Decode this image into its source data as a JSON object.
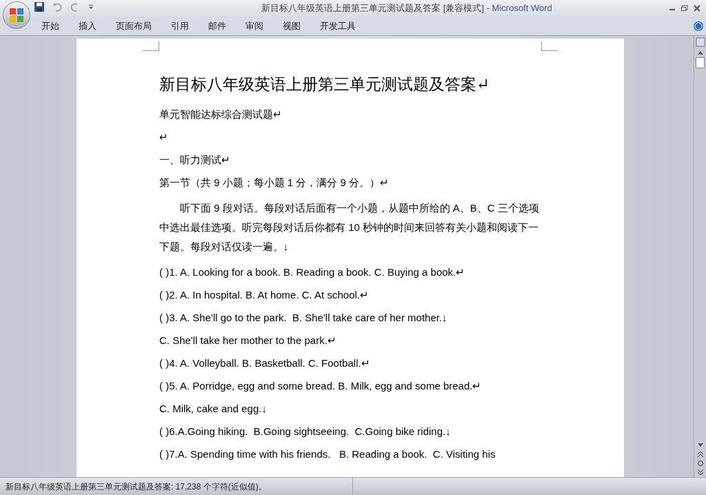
{
  "window": {
    "title": "新目标八年级英语上册第三单元测试题及答案 [兼容模式]",
    "separator": "-",
    "app_name": "Microsoft Word"
  },
  "ribbon_tabs": [
    {
      "label": "开始",
      "selected": false
    },
    {
      "label": "插入",
      "selected": false
    },
    {
      "label": "页面布局",
      "selected": false
    },
    {
      "label": "引用",
      "selected": false
    },
    {
      "label": "邮件",
      "selected": false
    },
    {
      "label": "审阅",
      "selected": false
    },
    {
      "label": "视图",
      "selected": false
    },
    {
      "label": "开发工具",
      "selected": false
    }
  ],
  "document": {
    "paragraphs": [
      {
        "kind": "title",
        "text": "新目标八年级英语上册第三单元测试题及答案↵"
      },
      {
        "kind": "text",
        "text": "单元智能达标综合测试题↵"
      },
      {
        "kind": "text",
        "text": "↵"
      },
      {
        "kind": "text",
        "text": "一、听力测试↵"
      },
      {
        "kind": "text",
        "text": "第一节（共 9 小题；每小题 1 分，满分 9 分。）↵"
      },
      {
        "kind": "wrapped",
        "text": "　　听下面 9 段对话。每段对话后面有一个小题，从题中所给的 A、B、C 三个选项中选出最佳选项。听完每段对话后你都有 10 秒钟的时间来回答有关小题和阅读下一下题。每段对话仅读一遍。↓"
      },
      {
        "kind": "text",
        "text": "( )1. A. Looking for a book. B. Reading a book. C. Buying a book.↵"
      },
      {
        "kind": "text",
        "text": "( )2. A. In hospital. B. At home. C. At school.↵"
      },
      {
        "kind": "text",
        "text": "( )3. A. She'll go to the park.  B. She'll take care of her mother.↓"
      },
      {
        "kind": "text",
        "text": "C. She'll take her mother to the park.↵"
      },
      {
        "kind": "text",
        "text": "( )4. A. Volleyball. B. Basketball. C. Football.↵"
      },
      {
        "kind": "text",
        "text": "( )5. A. Porridge, egg and some bread. B. Milk, egg and some bread.↵"
      },
      {
        "kind": "text",
        "text": "C. Milk, cake and egg.↓"
      },
      {
        "kind": "text",
        "text": "( )6.A.Going hiking.  B.Going sightseeing.  C.Going bike riding.↓"
      },
      {
        "kind": "text",
        "text": "( )7.A. Spending time with his friends.   B. Reading a book.  C. Visiting his"
      }
    ]
  },
  "status_bar": {
    "text": "新目标八年级英语上册第三单元测试题及答案: 17,238 个字符(近似值)。"
  }
}
